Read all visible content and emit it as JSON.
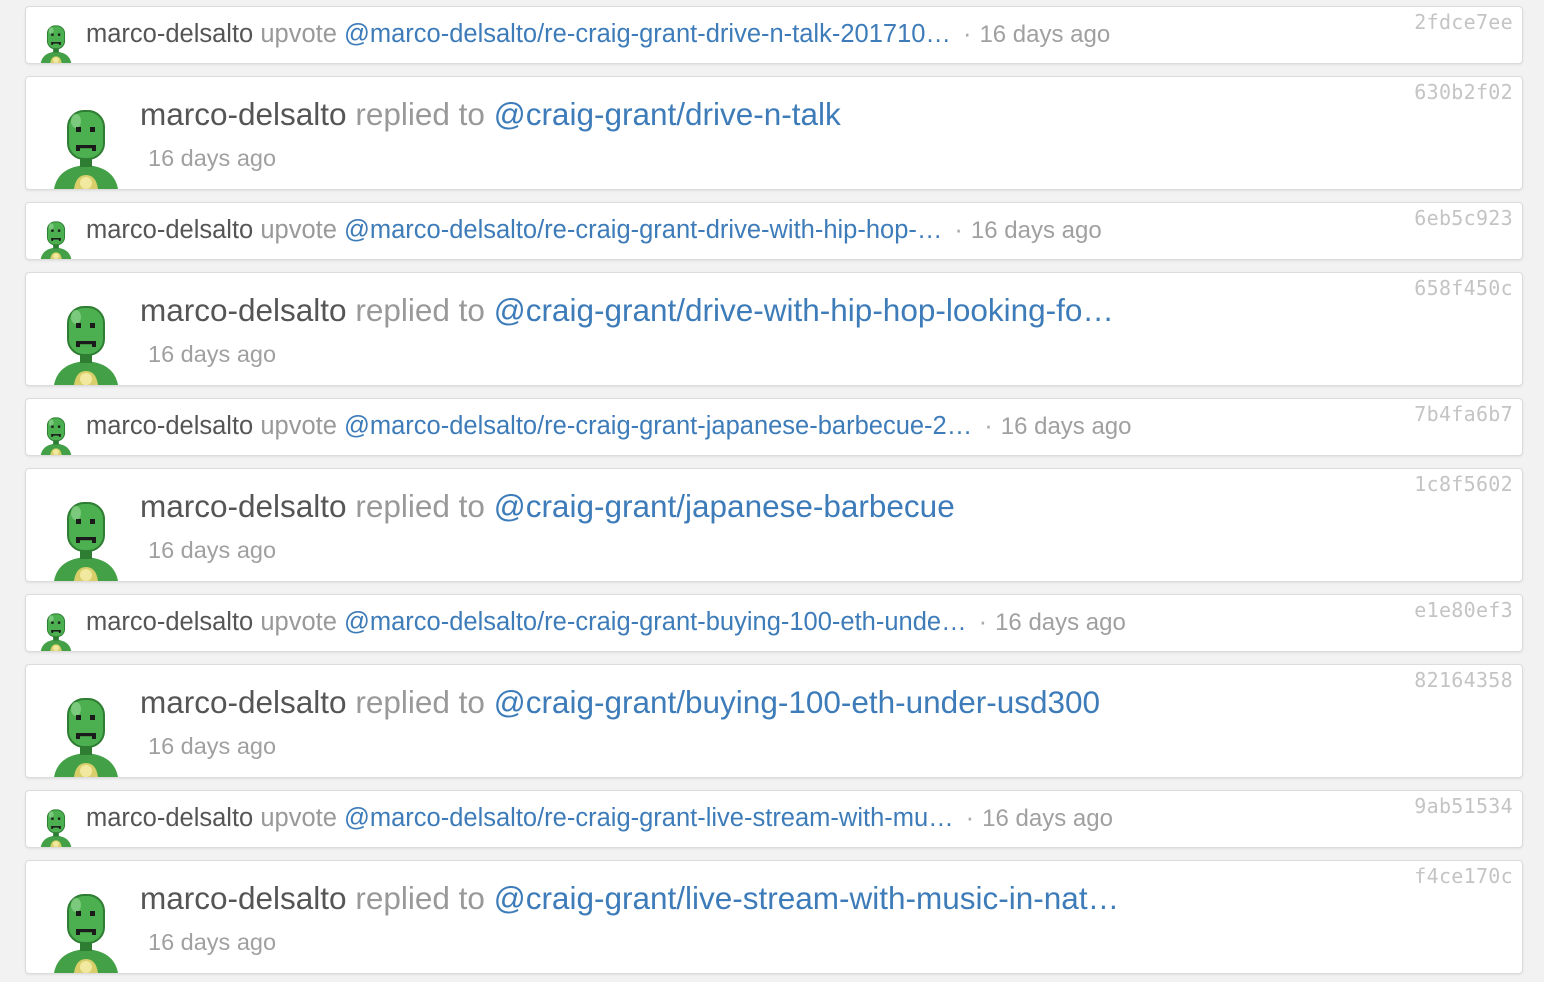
{
  "colors": {
    "link": "#3d7cb9",
    "username": "#555555",
    "muted": "#999999",
    "hash": "#c4c4c4",
    "avatar_green": "#4caf50"
  },
  "avatar_icon": "green-robot-avatar-icon",
  "separator": "·",
  "items": [
    {
      "type": "upvote",
      "user": "marco-delsalto",
      "verb": "upvote",
      "target": "@marco-delsalto/re-craig-grant-drive-n-talk-201710…",
      "time": "16 days ago",
      "hash": "2fdce7ee"
    },
    {
      "type": "reply",
      "user": "marco-delsalto",
      "verb": "replied to",
      "target": "@craig-grant/drive-n-talk",
      "time": "16 days ago",
      "hash": "630b2f02"
    },
    {
      "type": "upvote",
      "user": "marco-delsalto",
      "verb": "upvote",
      "target": "@marco-delsalto/re-craig-grant-drive-with-hip-hop-…",
      "time": "16 days ago",
      "hash": "6eb5c923"
    },
    {
      "type": "reply",
      "user": "marco-delsalto",
      "verb": "replied to",
      "target": "@craig-grant/drive-with-hip-hop-looking-fo…",
      "time": "16 days ago",
      "hash": "658f450c"
    },
    {
      "type": "upvote",
      "user": "marco-delsalto",
      "verb": "upvote",
      "target": "@marco-delsalto/re-craig-grant-japanese-barbecue-2…",
      "time": "16 days ago",
      "hash": "7b4fa6b7"
    },
    {
      "type": "reply",
      "user": "marco-delsalto",
      "verb": "replied to",
      "target": "@craig-grant/japanese-barbecue",
      "time": "16 days ago",
      "hash": "1c8f5602"
    },
    {
      "type": "upvote",
      "user": "marco-delsalto",
      "verb": "upvote",
      "target": "@marco-delsalto/re-craig-grant-buying-100-eth-unde…",
      "time": "16 days ago",
      "hash": "e1e80ef3"
    },
    {
      "type": "reply",
      "user": "marco-delsalto",
      "verb": "replied to",
      "target": "@craig-grant/buying-100-eth-under-usd300",
      "time": "16 days ago",
      "hash": "82164358"
    },
    {
      "type": "upvote",
      "user": "marco-delsalto",
      "verb": "upvote",
      "target": "@marco-delsalto/re-craig-grant-live-stream-with-mu…",
      "time": "16 days ago",
      "hash": "9ab51534"
    },
    {
      "type": "reply",
      "user": "marco-delsalto",
      "verb": "replied to",
      "target": "@craig-grant/live-stream-with-music-in-nat…",
      "time": "16 days ago",
      "hash": "f4ce170c"
    }
  ]
}
